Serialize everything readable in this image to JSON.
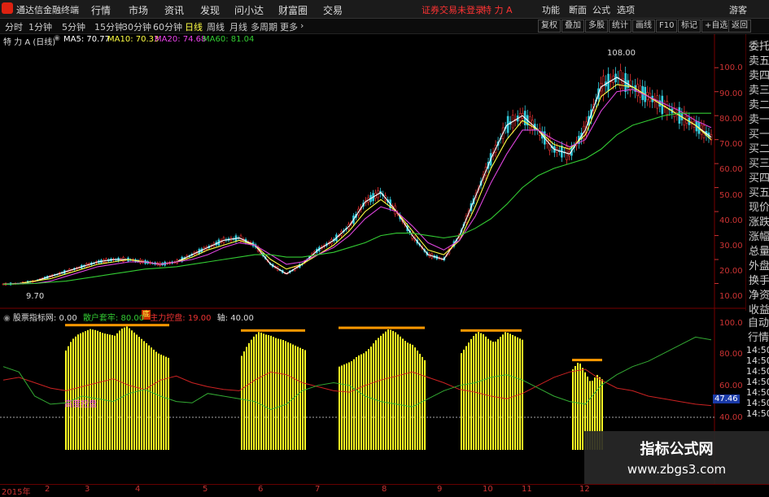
{
  "menu": {
    "app_title": "通达信金融终端",
    "items": [
      "行情",
      "市场",
      "资讯",
      "发现",
      "问小达",
      "财富圈",
      "交易"
    ],
    "alert": "证券交易未登录",
    "stock_title": "特 力 A",
    "right_items": [
      "功能",
      "断面",
      "公式",
      "选项"
    ],
    "guest": "游客"
  },
  "periods": {
    "items": [
      "分时",
      "1分钟",
      "5分钟",
      "15分钟",
      "30分钟",
      "60分钟",
      "日线",
      "周线",
      "月线",
      "多周期",
      "更多"
    ],
    "active": "日线",
    "tools": [
      "复权",
      "叠加",
      "多股",
      "统计",
      "画线",
      "F10",
      "标记",
      "+自选",
      "返回"
    ]
  },
  "indicators": {
    "name": "特 力 A (日线)",
    "ma5": "MA5: 70.77",
    "ma10": "MA10: 70.33",
    "ma20": "MA20: 74.68",
    "ma60": "MA60: 81.04"
  },
  "price_axis": [
    "100.0",
    "90.00",
    "80.00",
    "70.00",
    "60.00",
    "50.00",
    "40.00",
    "30.00",
    "20.00",
    "10.00"
  ],
  "annotations": {
    "high": "108.00",
    "low": "9.70",
    "marker": "底"
  },
  "sidebar": [
    "委托",
    "卖五",
    "卖四",
    "卖三",
    "卖二",
    "卖一",
    "买一",
    "买二",
    "买三",
    "买四",
    "买五",
    "现价",
    "涨跌",
    "涨幅",
    "总量",
    "外盘",
    "换手",
    "净资",
    "收益"
  ],
  "lower_panel": {
    "name": "股票指标网",
    "v0": ": 0.00",
    "retail": "散户套牢: 80.00",
    "main": "主力控盘: 19.00",
    "axis": "轴: 40.00",
    "label_control": "高度控盘",
    "axis_labels": [
      "100.0",
      "80.00",
      "60.00",
      "40.00"
    ],
    "current": "47.46"
  },
  "sidebar2": [
    "自动",
    "行情"
  ],
  "times": [
    "14:50",
    "14:50",
    "14:50",
    "14:50",
    "14:50",
    "14:50",
    "14:50"
  ],
  "timeaxis": [
    "2015年",
    "2",
    "3",
    "4",
    "5",
    "6",
    "7",
    "8",
    "9",
    "10",
    "11",
    "12"
  ],
  "watermark": {
    "title": "指标公式网",
    "url": "www.zbgs3.com"
  },
  "chart_data": {
    "type": "line",
    "ylim": [
      0,
      115
    ],
    "series": [
      {
        "name": "MA5",
        "color": "#ffffff",
        "values": [
          9.7,
          10,
          11,
          13,
          15,
          17,
          19,
          20,
          20,
          19,
          18,
          19,
          22,
          25,
          28,
          29,
          26,
          18,
          14,
          18,
          24,
          28,
          34,
          44,
          48,
          40,
          30,
          22,
          20,
          30,
          46,
          62,
          76,
          80,
          74,
          66,
          64,
          74,
          92,
          96,
          92,
          88,
          84,
          80,
          76,
          71
        ]
      },
      {
        "name": "MA10",
        "color": "#ffff44",
        "values": [
          9.7,
          10,
          11,
          12,
          14,
          16,
          18,
          19,
          20,
          19,
          18,
          19,
          21,
          24,
          26,
          28,
          26,
          20,
          16,
          18,
          22,
          26,
          32,
          40,
          45,
          40,
          32,
          24,
          22,
          28,
          42,
          58,
          70,
          78,
          74,
          68,
          66,
          72,
          88,
          93,
          92,
          88,
          84,
          80,
          76,
          70
        ]
      },
      {
        "name": "MA20",
        "color": "#dd44dd",
        "values": [
          9.7,
          10,
          10,
          11,
          13,
          15,
          17,
          18,
          19,
          19,
          18,
          19,
          20,
          22,
          25,
          27,
          26,
          22,
          18,
          19,
          22,
          25,
          30,
          37,
          42,
          40,
          34,
          27,
          24,
          28,
          38,
          52,
          64,
          74,
          74,
          70,
          67,
          70,
          82,
          90,
          91,
          88,
          85,
          82,
          78,
          75
        ]
      },
      {
        "name": "MA60",
        "color": "#33cc33",
        "values": [
          9.7,
          9.8,
          10,
          10.5,
          11,
          12,
          13,
          14,
          15,
          16,
          16.5,
          17,
          18,
          19,
          20,
          21,
          22,
          22,
          21,
          21,
          22,
          23,
          25,
          27,
          30,
          31,
          31,
          30,
          29,
          30,
          33,
          37,
          43,
          50,
          55,
          58,
          60,
          62,
          66,
          72,
          76,
          78,
          80,
          81,
          81,
          81
        ]
      }
    ],
    "lower_series": [
      {
        "name": "散户套牢",
        "color": "#cc2222",
        "values": [
          52,
          54,
          50,
          46,
          44,
          47,
          50,
          53,
          48,
          45,
          52,
          55,
          50,
          47,
          45,
          44,
          52,
          58,
          56,
          50,
          47,
          44,
          43,
          48,
          52,
          55,
          58,
          54,
          50,
          45,
          43,
          40,
          38,
          42,
          48,
          54,
          58,
          60,
          52,
          46,
          44,
          40,
          38,
          36,
          34,
          33
        ]
      },
      {
        "name": "主力控盘",
        "color": "#33aa33",
        "values": [
          62,
          58,
          40,
          34,
          35,
          40,
          38,
          36,
          42,
          45,
          40,
          36,
          35,
          42,
          40,
          38,
          36,
          30,
          34,
          44,
          48,
          50,
          48,
          40,
          36,
          34,
          32,
          38,
          44,
          48,
          50,
          54,
          56,
          52,
          46,
          40,
          36,
          34,
          48,
          56,
          62,
          66,
          72,
          78,
          84,
          82
        ]
      }
    ],
    "bars": [
      {
        "from": 80,
        "to": 208,
        "values": [
          74,
          82,
          86,
          88,
          90,
          89,
          87,
          86,
          85,
          90,
          92,
          88,
          84,
          80,
          76,
          72,
          70,
          68
        ]
      },
      {
        "from": 296,
        "to": 375,
        "values": [
          70,
          78,
          84,
          88,
          86,
          85,
          83,
          82,
          80,
          78,
          76,
          74
        ]
      },
      {
        "from": 416,
        "to": 522,
        "values": [
          62,
          64,
          66,
          70,
          72,
          76,
          82,
          86,
          90,
          88,
          84,
          80,
          78,
          72,
          66
        ]
      },
      {
        "from": 566,
        "to": 641,
        "values": [
          72,
          78,
          84,
          88,
          86,
          82,
          80,
          84,
          88,
          86,
          84,
          82
        ]
      },
      {
        "from": 703,
        "to": 740,
        "values": [
          60,
          66,
          58,
          50,
          56,
          52
        ]
      }
    ]
  }
}
